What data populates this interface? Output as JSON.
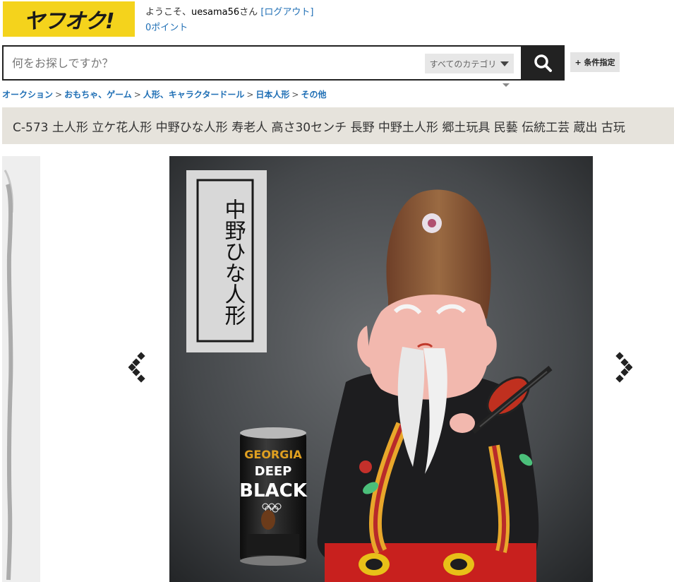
{
  "header": {
    "logo_text": "ヤフオク!",
    "welcome_prefix": "ようこそ、",
    "username": "uesama56",
    "welcome_suffix": "さん",
    "logout_label": "[ログアウト]",
    "points_label": "0ポイント"
  },
  "search": {
    "placeholder": "何をお探しですか？",
    "category_label": "すべてのカテゴリ",
    "condition_button_label": "+ 条件指定",
    "search_icon": "search-icon"
  },
  "breadcrumb": [
    {
      "label": "オークション"
    },
    {
      "label": "おもちゃ、ゲーム"
    },
    {
      "label": "人形、キャラクタードール"
    },
    {
      "label": "日本人形"
    },
    {
      "label": "その他"
    }
  ],
  "breadcrumb_separator": ">",
  "item": {
    "title": "C-573 土人形 立ケ花人形 中野ひな人形 寿老人 高さ30センチ 長野 中野土人形 郷土玩具 民藝 伝統工芸 蔵出 古玩"
  },
  "image_viewer": {
    "prev_icon": "chevron-left-icon",
    "next_icon": "chevron-right-icon",
    "stamp_text": "中野ひな人形",
    "can_brand": "GEORGIA",
    "can_line1": "DEEP",
    "can_line2": "BLACK"
  },
  "colors": {
    "logo_bg": "#f4d31c",
    "link": "#1f6fb5",
    "title_bar_bg": "#e6e3dc",
    "search_button_bg": "#222222"
  }
}
